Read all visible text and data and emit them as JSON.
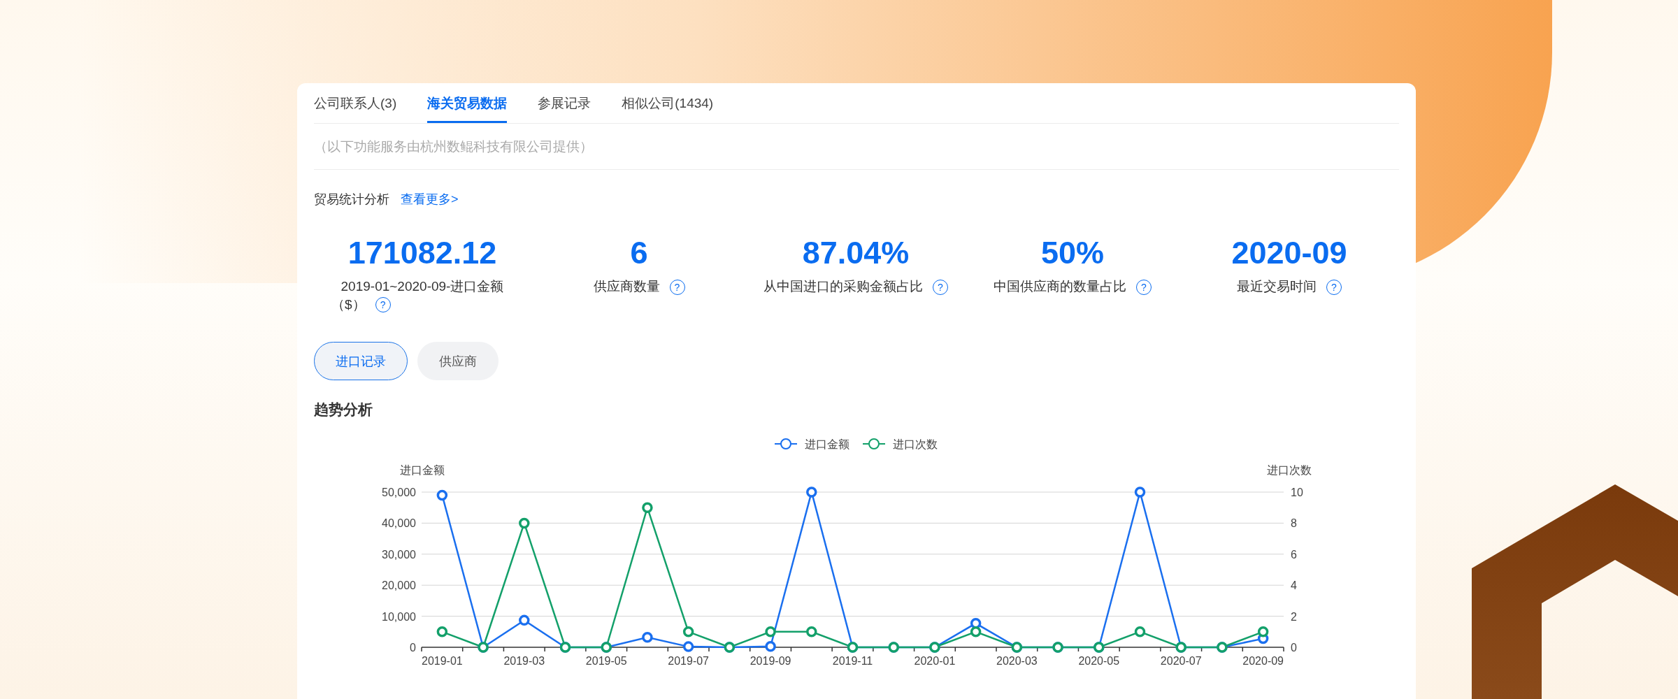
{
  "tabs": [
    {
      "label": "公司联系人(3)",
      "selected": false
    },
    {
      "label": "海关贸易数据",
      "selected": true
    },
    {
      "label": "参展记录",
      "selected": false
    },
    {
      "label": "相似公司(1434)",
      "selected": false
    }
  ],
  "notice": "（以下功能服务由杭州数鲲科技有限公司提供）",
  "section": {
    "title": "贸易统计分析",
    "link": "查看更多>"
  },
  "stats": [
    {
      "value": "171082.12",
      "label": "2019-01~2020-09-进口金额",
      "unit": "（$）",
      "help": "?"
    },
    {
      "value": "6",
      "label": "供应商数量",
      "help": "?"
    },
    {
      "value": "87.04%",
      "label": "从中国进口的采购金额占比",
      "help": "?"
    },
    {
      "value": "50%",
      "label": "中国供应商的数量占比",
      "help": "?"
    },
    {
      "value": "2020-09",
      "label": "最近交易时间",
      "help": "?"
    }
  ],
  "view_toggle": [
    {
      "label": "进口记录",
      "selected": true
    },
    {
      "label": "供应商",
      "selected": false
    }
  ],
  "trend": {
    "title": "趋势分析",
    "chart_data": {
      "type": "line",
      "grid": true,
      "legend": "top",
      "ylabel": "进口金额",
      "y2label": "进口次数",
      "categories": [
        "2019-01",
        null,
        "2019-03",
        null,
        "2019-05",
        null,
        "2019-07",
        null,
        "2019-09",
        null,
        "2019-11",
        null,
        "2020-01",
        null,
        "2020-03",
        null,
        "2020-05",
        null,
        "2020-07",
        null,
        "2020-09"
      ],
      "series": [
        {
          "name": "进口金额",
          "color": "#1a6fef",
          "axis": "y",
          "marker": "circle",
          "values": [
            49000,
            0,
            8700,
            0,
            0,
            3200,
            200,
            0,
            300,
            50000,
            0,
            0,
            0,
            7700,
            0,
            0,
            0,
            50000,
            0,
            0,
            2800
          ]
        },
        {
          "name": "进口次数",
          "color": "#13a06a",
          "axis": "y2",
          "marker": "circle",
          "values": [
            1,
            0,
            8,
            0,
            0,
            9,
            1,
            0,
            1,
            1,
            0,
            0,
            0,
            1,
            0,
            0,
            0,
            1,
            0,
            0,
            1
          ]
        }
      ],
      "ylim": [
        0,
        50000
      ],
      "y2lim": [
        0,
        10
      ],
      "yticks": [
        {
          "value": 0,
          "label": "0"
        },
        {
          "value": 10000,
          "label": "10,000"
        },
        {
          "value": 20000,
          "label": "20,000"
        },
        {
          "value": 30000,
          "label": "30,000"
        },
        {
          "value": 40000,
          "label": "40,000"
        },
        {
          "value": 50000,
          "label": "50,000"
        }
      ],
      "y2ticks": [
        0,
        2,
        4,
        6,
        8,
        10
      ]
    }
  }
}
